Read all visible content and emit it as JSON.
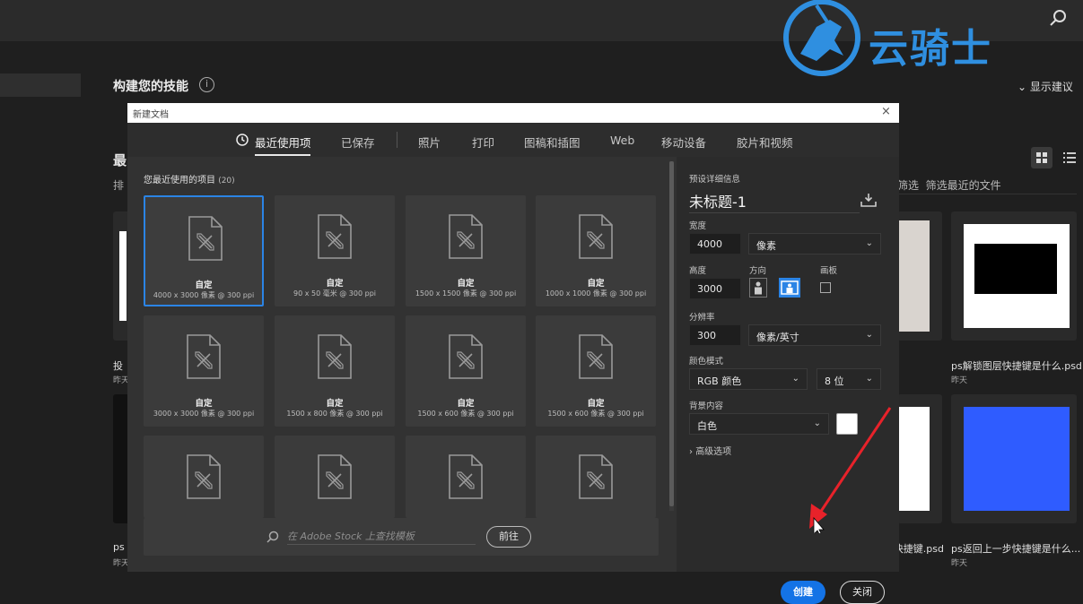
{
  "watermark": {
    "text": "云骑士"
  },
  "background": {
    "skills_title": "构建您的技能",
    "show_suggestions": "显示建议",
    "left_title": "最",
    "left_sort": "排",
    "filter_label": "筛选",
    "filter_recent": "筛选最近的文件",
    "files": [
      {
        "name": "投",
        "date": "昨天"
      },
      {
        "name": "ps",
        "date": "昨天"
      },
      {
        "name": "ps解锁图层快捷键是什么.psd",
        "date": "昨天"
      },
      {
        "name": "快捷键.psd",
        "date": ""
      },
      {
        "name": "ps返回上一步快捷键是什么...",
        "date": "昨天"
      }
    ]
  },
  "dialog": {
    "title": "新建文档",
    "close_glyph": "×",
    "tabs": [
      {
        "label": "最近使用项",
        "active": true
      },
      {
        "label": "已保存"
      },
      {
        "label": "照片"
      },
      {
        "label": "打印"
      },
      {
        "label": "图稿和插图"
      },
      {
        "label": "Web"
      },
      {
        "label": "移动设备"
      },
      {
        "label": "胶片和视频"
      }
    ],
    "recent_label": "您最近使用的项目",
    "recent_count": "(20)",
    "presets": [
      {
        "name": "自定",
        "desc": "4000 x 3000 像素 @ 300 ppi"
      },
      {
        "name": "自定",
        "desc": "90 x 50 毫米 @ 300 ppi"
      },
      {
        "name": "自定",
        "desc": "1500 x 1500 像素 @ 300 ppi"
      },
      {
        "name": "自定",
        "desc": "1000 x 1000 像素 @ 300 ppi"
      },
      {
        "name": "自定",
        "desc": "3000 x 3000 像素 @ 300 ppi"
      },
      {
        "name": "自定",
        "desc": "1500 x 800 像素 @ 300 ppi"
      },
      {
        "name": "自定",
        "desc": "1500 x 600 像素 @ 300 ppi"
      },
      {
        "name": "自定",
        "desc": "1500 x 600 像素 @ 300 ppi"
      },
      {
        "name": "",
        "desc": ""
      },
      {
        "name": "",
        "desc": ""
      },
      {
        "name": "",
        "desc": ""
      },
      {
        "name": "",
        "desc": ""
      }
    ],
    "stock_placeholder": "在 Adobe Stock 上查找模板",
    "goto_label": "前往",
    "details": {
      "section_label": "预设详细信息",
      "doc_name": "未标题-1",
      "width_label": "宽度",
      "width_value": "4000",
      "width_unit": "像素",
      "height_label": "高度",
      "height_value": "3000",
      "orientation_label": "方向",
      "artboard_label": "画板",
      "resolution_label": "分辨率",
      "resolution_value": "300",
      "resolution_unit": "像素/英寸",
      "color_mode_label": "颜色模式",
      "color_mode_value": "RGB 颜色",
      "bit_depth_value": "8 位",
      "bg_label": "背景内容",
      "bg_value": "白色",
      "bg_swatch_color": "#ffffff",
      "advanced_label": "高级选项"
    },
    "create_label": "创建",
    "close_label": "关闭"
  }
}
